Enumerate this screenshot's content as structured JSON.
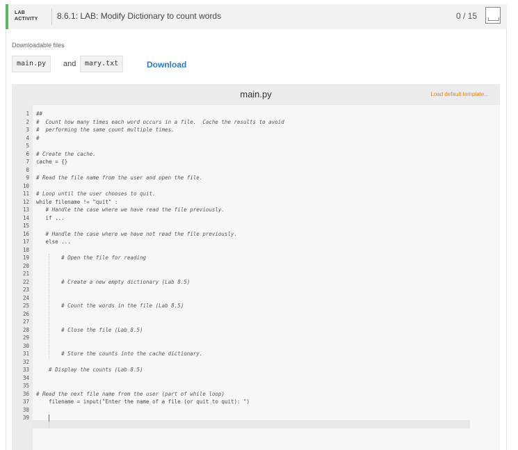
{
  "header": {
    "badge_line1": "LAB",
    "badge_line2": "ACTIVITY",
    "title": "8.6.1: LAB: Modify Dictionary to count words",
    "score": "0 / 15"
  },
  "downloads": {
    "label": "Downloadable files",
    "file1": "main.py",
    "and": "and",
    "file2": "mary.txt",
    "download_label": "Download"
  },
  "editor": {
    "filename": "main.py",
    "load_template": "Load default template...",
    "lines": [
      {
        "n": "1",
        "text": "##"
      },
      {
        "n": "2",
        "text": "#  Count how many times each word occurs in a file.  Cache the results to avoid"
      },
      {
        "n": "3",
        "text": "#  performing the same count multiple times."
      },
      {
        "n": "4",
        "text": "#"
      },
      {
        "n": "5",
        "text": ""
      },
      {
        "n": "6",
        "text": "# Create the cache."
      },
      {
        "n": "7",
        "text": "cache = {}"
      },
      {
        "n": "8",
        "text": ""
      },
      {
        "n": "9",
        "text": "# Read the file name from the user and open the file."
      },
      {
        "n": "10",
        "text": ""
      },
      {
        "n": "11",
        "text": "# Loop until the user chooses to quit."
      },
      {
        "n": "12",
        "text": "while filename != \"quit\" :"
      },
      {
        "n": "13",
        "text": "   # Handle the case where we have read the file previously."
      },
      {
        "n": "14",
        "text": "   if ..."
      },
      {
        "n": "15",
        "text": ""
      },
      {
        "n": "16",
        "text": "   # Handle the case where we have not read the file previously."
      },
      {
        "n": "17",
        "text": "   else ..."
      },
      {
        "n": "18",
        "text": ""
      },
      {
        "n": "19",
        "text": "        # Open the file for reading"
      },
      {
        "n": "20",
        "text": ""
      },
      {
        "n": "21",
        "text": ""
      },
      {
        "n": "22",
        "text": "        # Create a new empty dictionary (Lab 8.5)"
      },
      {
        "n": "23",
        "text": ""
      },
      {
        "n": "24",
        "text": ""
      },
      {
        "n": "25",
        "text": "        # Count the words in the file (Lab 8.5)"
      },
      {
        "n": "26",
        "text": ""
      },
      {
        "n": "27",
        "text": ""
      },
      {
        "n": "28",
        "text": "        # Close the file (Lab 8.5)"
      },
      {
        "n": "29",
        "text": ""
      },
      {
        "n": "30",
        "text": ""
      },
      {
        "n": "31",
        "text": "        # Store the counts into the cache dictionary."
      },
      {
        "n": "32",
        "text": ""
      },
      {
        "n": "33",
        "text": "    # Display the counts (Lab 8.5)"
      },
      {
        "n": "34",
        "text": ""
      },
      {
        "n": "35",
        "text": ""
      },
      {
        "n": "36",
        "text": "# Read the next file name from the user (part of while loop)"
      },
      {
        "n": "37",
        "text": "    filename = input(\"Enter the name of a file (or quit to quit): \")"
      },
      {
        "n": "38",
        "text": ""
      },
      {
        "n": "39",
        "text": ""
      }
    ]
  }
}
